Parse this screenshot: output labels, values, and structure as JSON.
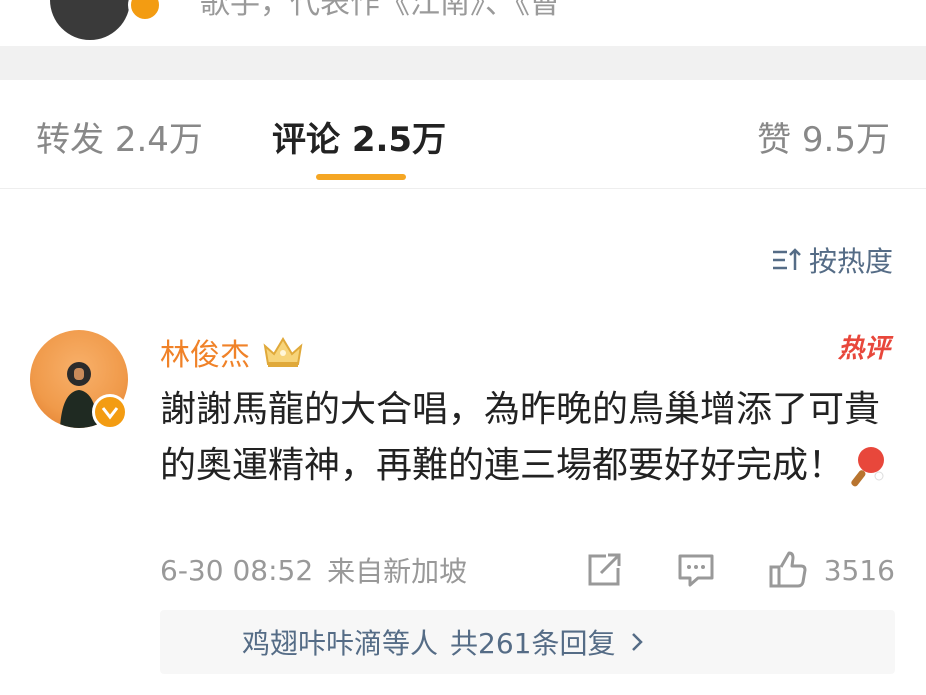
{
  "header": {
    "bio_text": "歌手，代表作《江南》、《曹"
  },
  "tabs": {
    "repost_label": "转发",
    "repost_count": "2.4万",
    "comment_label": "评论",
    "comment_count": "2.5万",
    "like_label": "赞",
    "like_count": "9.5万",
    "active": "comment"
  },
  "sort": {
    "label": "按热度",
    "icon": "sort-icon"
  },
  "comment": {
    "username": "林俊杰",
    "badge_icon": "crown-badge-icon",
    "hot_tag": "热评",
    "text": "謝謝馬龍的大合唱，為昨晚的鳥巢增添了可貴的奧運精神，再難的連三場都要好好完成！",
    "emoji": "ping-pong-icon",
    "time": "6-30 08:52",
    "location": "来自新加坡",
    "like_count": "3516",
    "replies_preview": "鸡翅咔咔滴等人",
    "replies_total": "共261条回复"
  },
  "colors": {
    "accent": "#f5a623",
    "username": "#f08228",
    "link": "#556c86",
    "hot": "#e8473b"
  }
}
